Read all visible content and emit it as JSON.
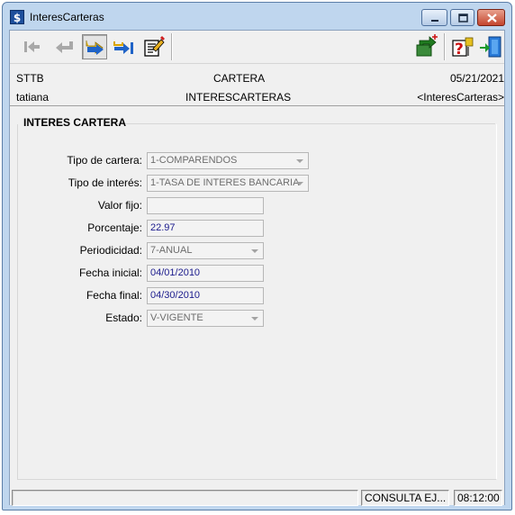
{
  "window": {
    "app_icon_glyph": "$",
    "title": "InteresCarteras"
  },
  "toolbar": {
    "buttons": [
      {
        "icon": "first-record-icon",
        "enabled": false
      },
      {
        "icon": "previous-record-icon",
        "enabled": false
      },
      {
        "icon": "next-record-icon",
        "enabled": true,
        "pressed": true
      },
      {
        "icon": "last-record-icon",
        "enabled": true
      },
      {
        "icon": "edit-record-icon",
        "enabled": true
      },
      {
        "icon": "back-help-icon",
        "enabled": true
      },
      {
        "icon": "help-icon",
        "enabled": true
      },
      {
        "icon": "exit-door-icon",
        "enabled": true
      }
    ]
  },
  "info": {
    "company": "STTB",
    "module": "CARTERA",
    "date": "05/21/2021",
    "user": "tatiana",
    "table": "INTERESCARTERAS",
    "form": "<InteresCarteras>"
  },
  "section": {
    "title": "INTERES CARTERA"
  },
  "form": {
    "tipo_cartera": {
      "label": "Tipo de cartera:",
      "value": "1-COMPARENDOS"
    },
    "tipo_interes": {
      "label": "Tipo de interés:",
      "value": "1-TASA DE INTERES BANCARIA"
    },
    "valor_fijo": {
      "label": "Valor fijo:",
      "value": ""
    },
    "porcentaje": {
      "label": "Porcentaje:",
      "value": "22.97"
    },
    "periodicidad": {
      "label": "Periodicidad:",
      "value": "7-ANUAL"
    },
    "fecha_inicial": {
      "label": "Fecha inicial:",
      "value": "04/01/2010"
    },
    "fecha_final": {
      "label": "Fecha final:",
      "value": "04/30/2010"
    },
    "estado": {
      "label": "Estado:",
      "value": "V-VIGENTE"
    }
  },
  "status": {
    "message": "",
    "mode": "CONSULTA EJ...",
    "time": "08:12:00"
  },
  "colors": {
    "field_value": "#1a1a8c",
    "disabled_text": "#6d6d6d",
    "titlebar": "#bfd6ee",
    "close_button": "#c4462e"
  }
}
